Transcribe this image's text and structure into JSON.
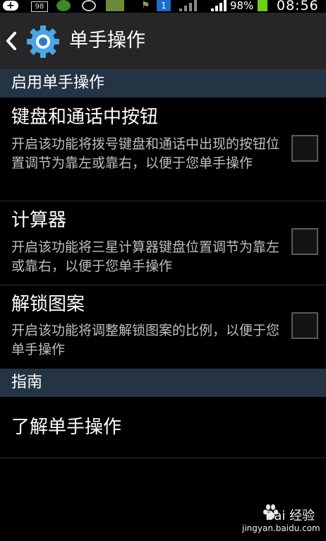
{
  "status_bar": {
    "notification_count": "98",
    "flag_badge": "1",
    "battery": "98%",
    "time": "08:56",
    "battery_color": "#6bd11a"
  },
  "header": {
    "title": "单手操作",
    "back_icon": "chevron-left-icon",
    "app_icon": "gear-icon"
  },
  "sections": [
    {
      "title": "启用单手操作",
      "items": [
        {
          "title": "键盘和通话中按钮",
          "description": "开启该功能将拨号键盘和通话中出现的按钮位置调节为靠左或靠右，以便于您单手操作",
          "checked": false
        },
        {
          "title": "计算器",
          "description": "开启该功能将三星计算器键盘位置调节为靠左或靠右，以便于您单手操作",
          "checked": false
        },
        {
          "title": "解锁图案",
          "description": "开启该功能将调整解锁图案的比例，以便于您单手操作",
          "checked": false
        }
      ]
    },
    {
      "title": "指南",
      "items": [
        {
          "title": "了解单手操作"
        }
      ]
    }
  ],
  "watermark": {
    "brand": "Bai 经验",
    "url": "jingyan.baidu.com"
  },
  "colors": {
    "section_header_bg": "#253445",
    "action_bar_bg": "#262626",
    "background": "#000000"
  }
}
